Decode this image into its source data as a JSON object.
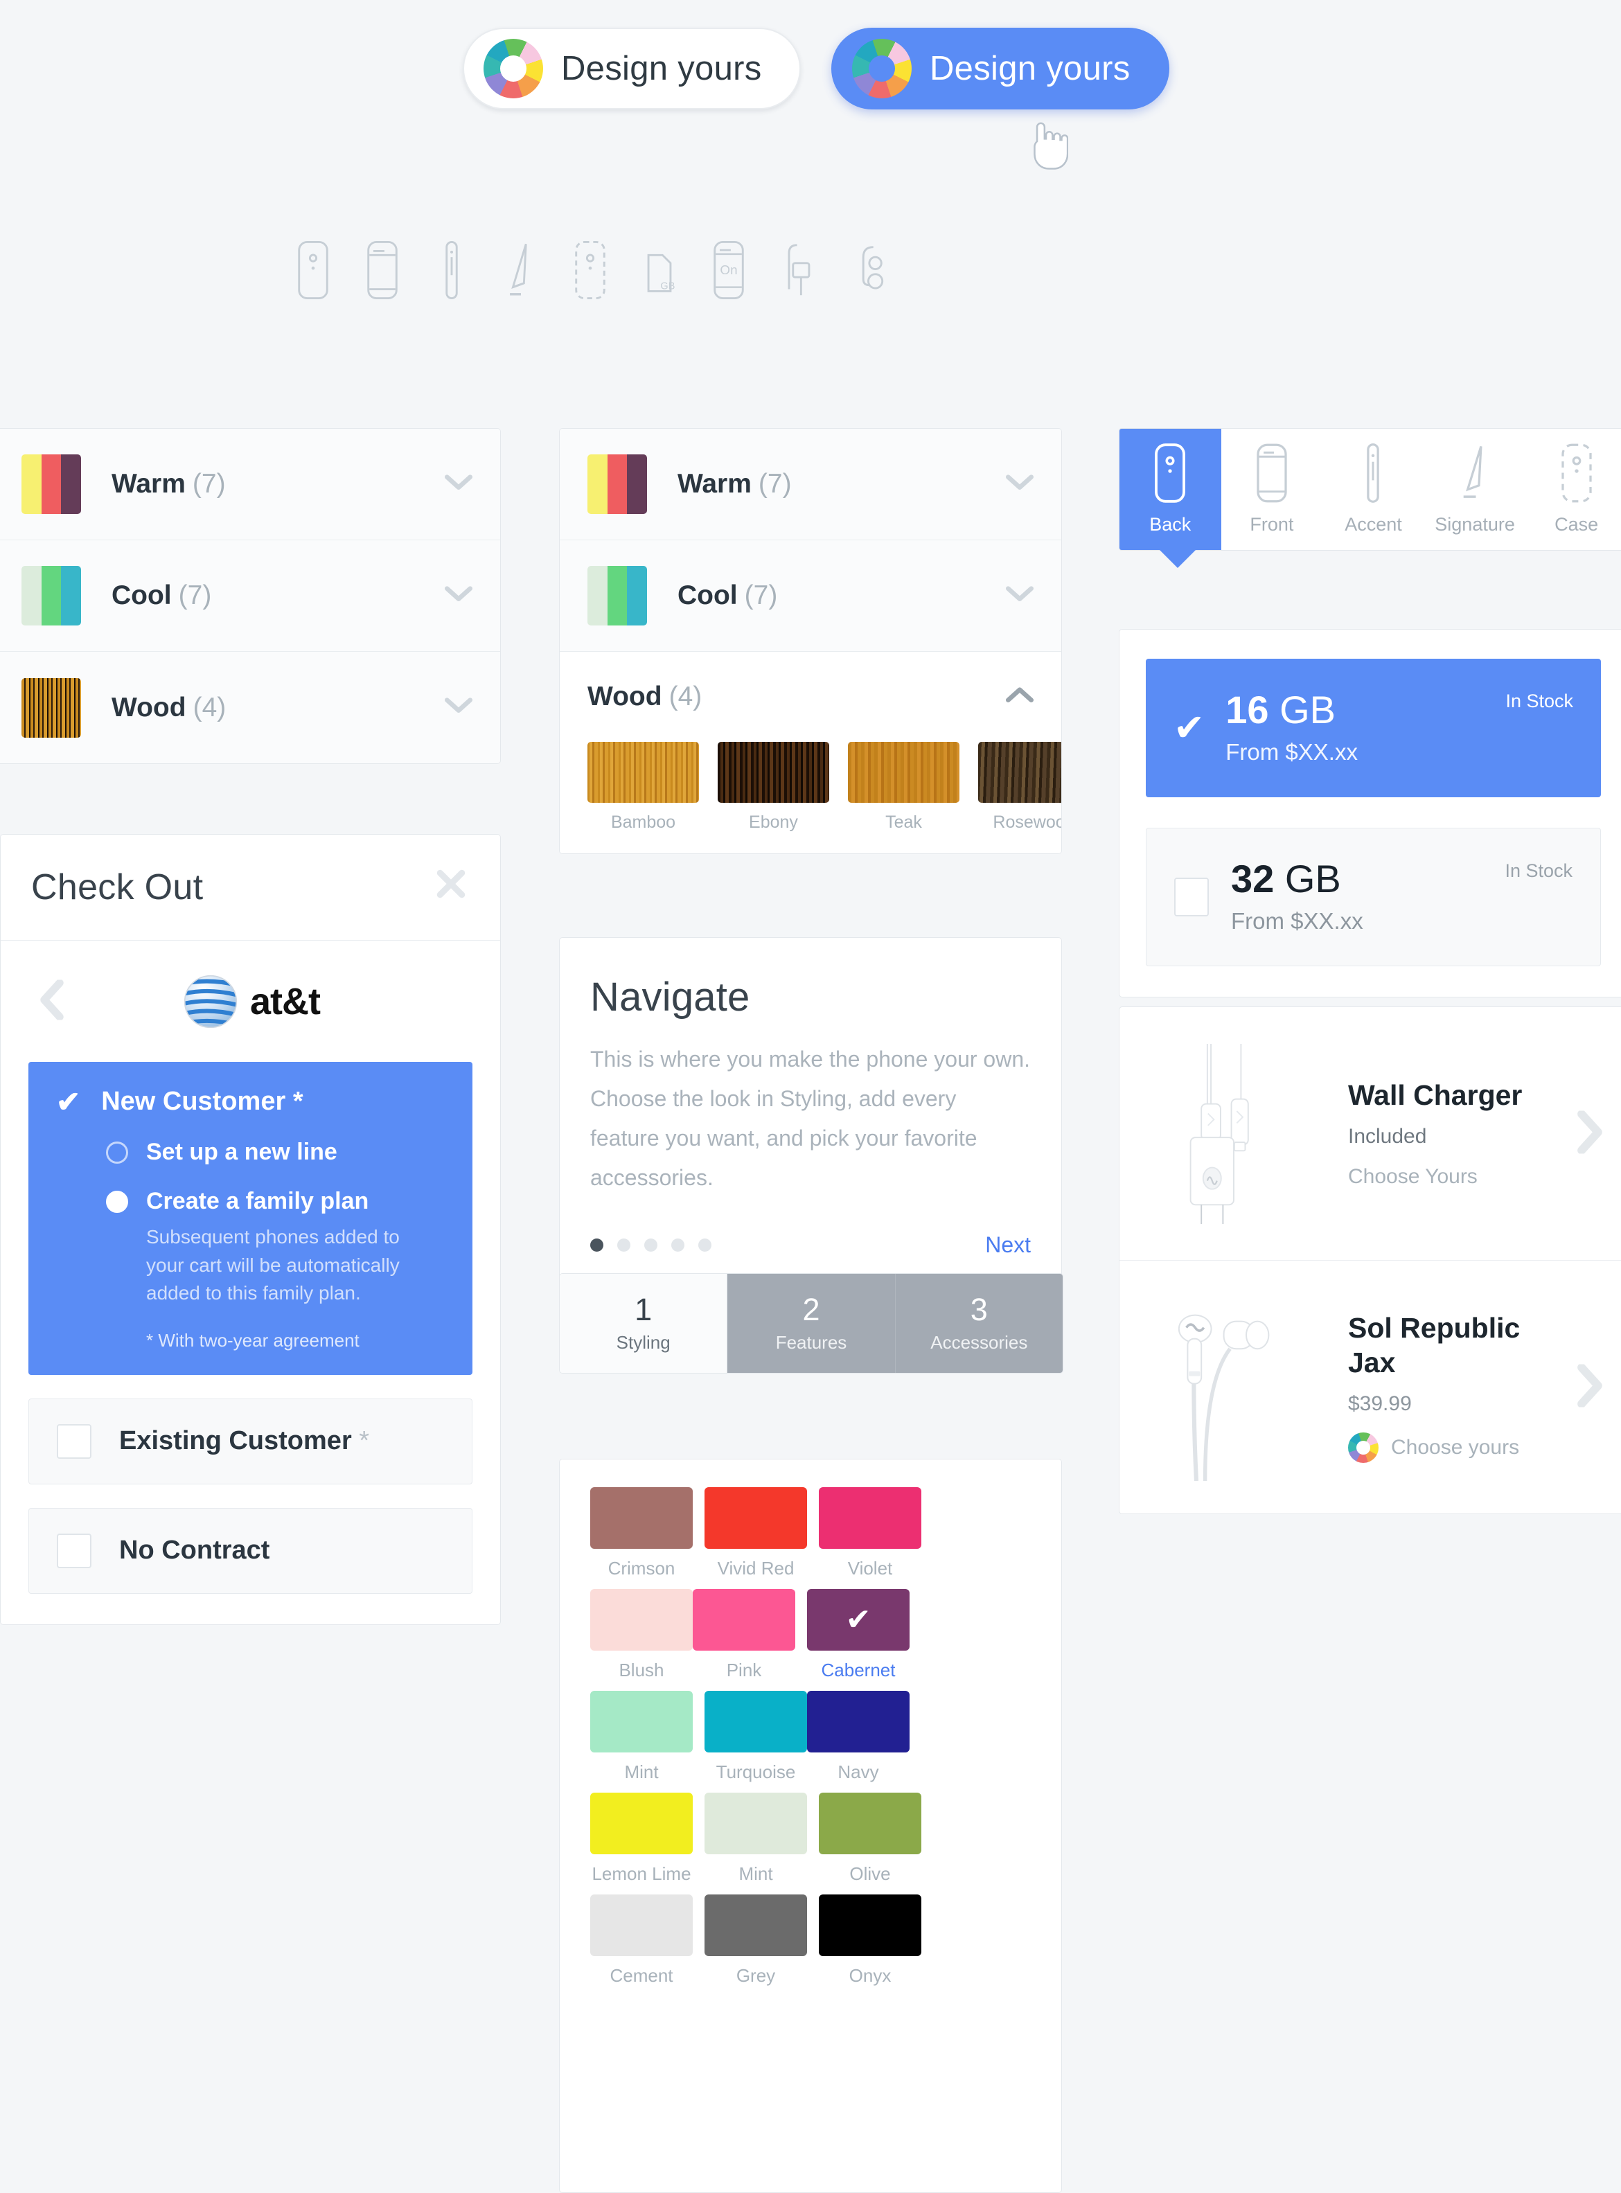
{
  "theme": {
    "accent_blue": "#5a8cf5",
    "page_bg": "#f4f6f8",
    "card_bg": "#ffffff",
    "muted_text": "#a8b2ba"
  },
  "top_buttons": [
    {
      "label": "Design yours",
      "style": "light",
      "icon": "color-wheel-icon"
    },
    {
      "label": "Design yours",
      "style": "blue",
      "icon": "color-wheel-icon"
    }
  ],
  "icon_strip": [
    {
      "name": "phone-back-icon"
    },
    {
      "name": "phone-front-icon"
    },
    {
      "name": "phone-accent-icon"
    },
    {
      "name": "signature-pen-icon"
    },
    {
      "name": "phone-case-icon"
    },
    {
      "name": "memory-gb-icon",
      "label": "GB"
    },
    {
      "name": "carrier-on-icon",
      "label": "On"
    },
    {
      "name": "wall-charger-icon"
    },
    {
      "name": "headphones-icon"
    }
  ],
  "palette_left": {
    "rows": [
      {
        "name": "Warm",
        "count": "(7)",
        "colors": [
          "#f7f071",
          "#ef5d60",
          "#643c58"
        ],
        "state": "collapsed",
        "chevron": "chevron-down-icon"
      },
      {
        "name": "Cool",
        "count": "(7)",
        "colors": [
          "#dcecdc",
          "#63d67f",
          "#38b6c9"
        ],
        "state": "collapsed",
        "chevron": "chevron-down-icon"
      },
      {
        "name": "Wood",
        "count": "(4)",
        "texture": "wood",
        "state": "collapsed",
        "chevron": "chevron-down-icon"
      }
    ]
  },
  "palette_mid": {
    "rows": [
      {
        "name": "Warm",
        "count": "(7)",
        "colors": [
          "#f7f071",
          "#ef5d60",
          "#643c58"
        ],
        "state": "collapsed",
        "chevron": "chevron-down-icon"
      },
      {
        "name": "Cool",
        "count": "(7)",
        "colors": [
          "#dcecdc",
          "#63d67f",
          "#38b6c9"
        ],
        "state": "collapsed",
        "chevron": "chevron-down-icon"
      }
    ],
    "expanded": {
      "name": "Wood",
      "count": "(4)",
      "chevron": "chevron-up-icon",
      "items": [
        {
          "label": "Bamboo",
          "texture": "tx-bamboo"
        },
        {
          "label": "Ebony",
          "texture": "tx-ebony"
        },
        {
          "label": "Teak",
          "texture": "tx-teak"
        },
        {
          "label": "Rosewood",
          "texture": "tx-rosewood"
        }
      ]
    }
  },
  "checkout": {
    "title": "Check Out",
    "close_icon": "close-icon",
    "prev_icon": "chevron-left-icon",
    "carrier": {
      "name": "at&t",
      "logo": "att-globe-icon"
    },
    "new_customer": {
      "label": "New Customer *",
      "check_icon": "check-icon",
      "options": [
        {
          "label": "Set up a new line",
          "selected": false
        },
        {
          "label": "Create a family plan",
          "selected": true,
          "description": "Subsequent phones added to your cart will be automatically added to this family plan."
        }
      ],
      "footnote": "* With two-year agreement"
    },
    "other_options": [
      {
        "label": "Existing Customer",
        "star": " *",
        "checked": false
      },
      {
        "label": "No Contract",
        "star": "",
        "checked": false
      }
    ]
  },
  "navigate": {
    "title": "Navigate",
    "body": "This is where you make the phone your own. Choose the look in Styling, add every feature you want, and pick your favorite accessories.",
    "dots_total": 5,
    "dots_active": 1,
    "next_label": "Next"
  },
  "steps": [
    {
      "number": "1",
      "label": "Styling",
      "active": true
    },
    {
      "number": "2",
      "label": "Features",
      "active": false
    },
    {
      "number": "3",
      "label": "Accessories",
      "active": false
    }
  ],
  "color_grid": {
    "swatches": [
      {
        "label": "Crimson",
        "hex": "#a5706a",
        "selected": false
      },
      {
        "label": "Vivid Red",
        "hex": "#f4382b",
        "selected": false
      },
      {
        "label": "Violet",
        "hex": "#ec2f71",
        "selected": false
      },
      {
        "label": "Blush",
        "hex": "#fbdcd9",
        "selected": false
      },
      {
        "label": "Pink",
        "hex": "#fc5793",
        "selected": false
      },
      {
        "label": "Cabernet",
        "hex": "#79386d",
        "selected": true,
        "check_icon": "check-icon"
      },
      {
        "label": "Mint",
        "hex": "#a5e9c6",
        "selected": false
      },
      {
        "label": "Turquoise",
        "hex": "#09b0c8",
        "selected": false
      },
      {
        "label": "Navy",
        "hex": "#222092",
        "selected": false
      },
      {
        "label": "Lemon Lime",
        "hex": "#f2ee1f",
        "selected": false
      },
      {
        "label": "Mint",
        "hex": "#dfeadb",
        "selected": false
      },
      {
        "label": "Olive",
        "hex": "#8ba949",
        "selected": false
      },
      {
        "label": "Cement",
        "hex": "#e6e6e6",
        "selected": false
      },
      {
        "label": "Grey",
        "hex": "#6b6b6b",
        "selected": false
      },
      {
        "label": "Onyx",
        "hex": "#000000",
        "selected": false
      }
    ]
  },
  "part_tabs": [
    {
      "label": "Back",
      "icon": "phone-back-icon",
      "active": true
    },
    {
      "label": "Front",
      "icon": "phone-front-icon",
      "active": false
    },
    {
      "label": "Accent",
      "icon": "phone-accent-icon",
      "active": false
    },
    {
      "label": "Signature",
      "icon": "signature-pen-icon",
      "active": false
    },
    {
      "label": "Case",
      "icon": "phone-case-icon",
      "active": false
    }
  ],
  "storage": [
    {
      "size": "16",
      "unit": "GB",
      "price": "From $XX.xx",
      "stock": "In Stock",
      "selected": true,
      "check_icon": "check-icon"
    },
    {
      "size": "32",
      "unit": "GB",
      "price": "From $XX.xx",
      "stock": "In Stock",
      "selected": false
    }
  ],
  "accessories": [
    {
      "title": "Wall Charger",
      "subtitle": "Included",
      "action": "Choose Yours",
      "image": "wall-charger-image",
      "chevron": "chevron-right-icon",
      "has_wheel": false
    },
    {
      "title": "Sol Republic Jax",
      "price": "$39.99",
      "action": "Choose yours",
      "image": "earbuds-image",
      "chevron": "chevron-right-icon",
      "has_wheel": true,
      "wheel_icon": "color-wheel-icon"
    }
  ]
}
